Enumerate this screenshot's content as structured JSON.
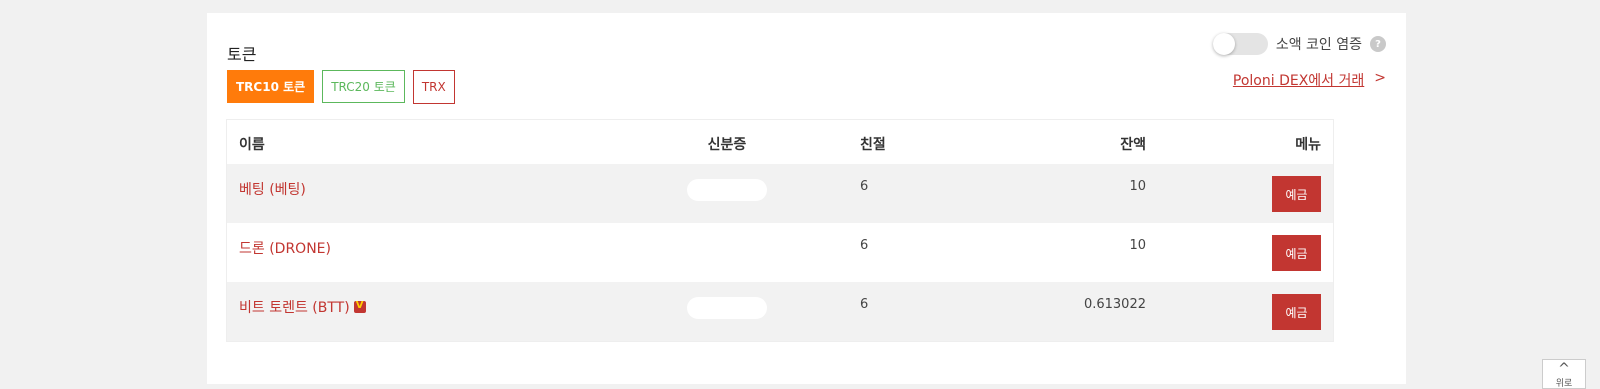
{
  "section": {
    "title": "토큰",
    "tabs": [
      {
        "label": "TRC10 토큰"
      },
      {
        "label": "TRC20 토큰"
      },
      {
        "label": "TRX"
      }
    ],
    "toggle_label": "소액 코인 염증",
    "help_label": "?",
    "dex_link": {
      "label": "Poloni DEX에서 거래",
      "arrow": ">"
    }
  },
  "table": {
    "headers": [
      "이름",
      "신분증",
      "친절",
      "잔액",
      "메뉴"
    ],
    "rows": [
      {
        "name": "베팅 (베팅)",
        "id": "",
        "precision": "6",
        "balance": "10",
        "action": "예금"
      },
      {
        "name": "드론 (DRONE)",
        "id": "",
        "precision": "6",
        "balance": "10",
        "action": "예금"
      },
      {
        "name": "비트 토렌트 (BTT)",
        "id": "",
        "precision": "6",
        "balance": "0.613022",
        "action": "예금"
      }
    ]
  },
  "scroll_top": {
    "icon": "chevron-up-icon",
    "label": "위로"
  },
  "colors": {
    "accent_orange": "#ff7b0b",
    "accent_red": "#c23631",
    "green": "#5cb85c"
  }
}
